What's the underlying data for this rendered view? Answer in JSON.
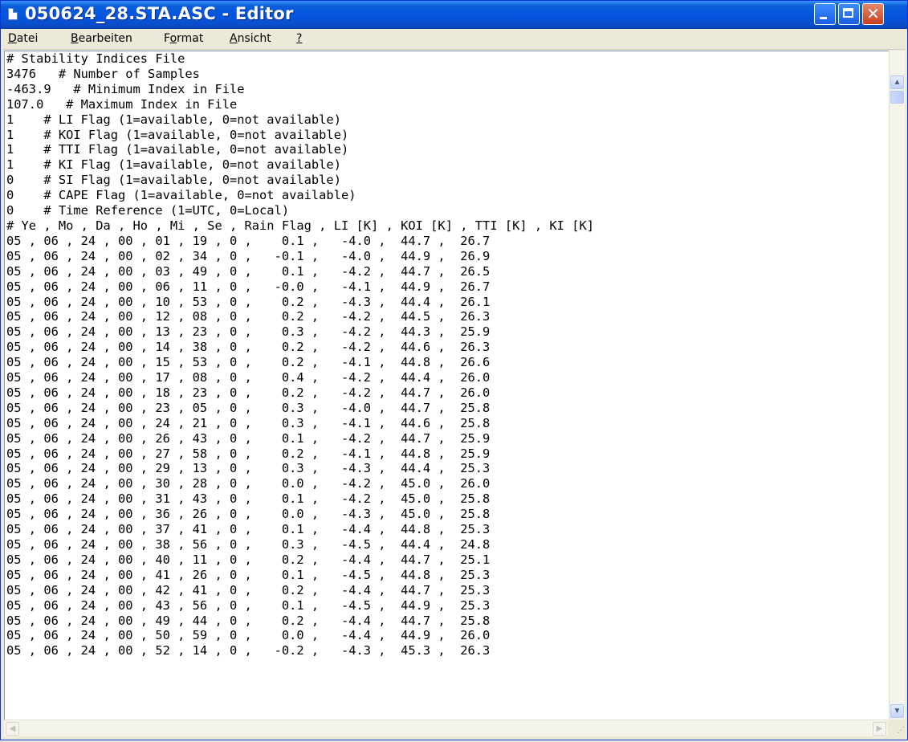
{
  "window": {
    "title": "050624_28.STA.ASC - Editor",
    "buttons": {
      "minimize": "minimize-icon",
      "maximize": "maximize-icon",
      "close": "close-icon"
    }
  },
  "menu": [
    {
      "accel": "D",
      "rest": "atei"
    },
    {
      "accel": "B",
      "rest": "earbeiten"
    },
    {
      "pre": "F",
      "accel": "o",
      "rest": "rmat"
    },
    {
      "accel": "A",
      "rest": "nsicht"
    },
    {
      "accel": "?",
      "rest": ""
    }
  ],
  "editor": {
    "lines": [
      "# Stability Indices File",
      "3476   # Number of Samples",
      "-463.9   # Minimum Index in File",
      "107.0   # Maximum Index in File",
      "1    # LI Flag (1=available, 0=not available)",
      "1    # KOI Flag (1=available, 0=not available)",
      "1    # TTI Flag (1=available, 0=not available)",
      "1    # KI Flag (1=available, 0=not available)",
      "0    # SI Flag (1=available, 0=not available)",
      "0    # CAPE Flag (1=available, 0=not available)",
      "0    # Time Reference (1=UTC, 0=Local)",
      "# Ye , Mo , Da , Ho , Mi , Se , Rain Flag , LI [K] , KOI [K] , TTI [K] , KI [K]",
      "05 , 06 , 24 , 00 , 01 , 19 , 0 ,    0.1 ,   -4.0 ,  44.7 ,  26.7",
      "05 , 06 , 24 , 00 , 02 , 34 , 0 ,   -0.1 ,   -4.0 ,  44.9 ,  26.9",
      "05 , 06 , 24 , 00 , 03 , 49 , 0 ,    0.1 ,   -4.2 ,  44.7 ,  26.5",
      "05 , 06 , 24 , 00 , 06 , 11 , 0 ,   -0.0 ,   -4.1 ,  44.9 ,  26.7",
      "05 , 06 , 24 , 00 , 10 , 53 , 0 ,    0.2 ,   -4.3 ,  44.4 ,  26.1",
      "05 , 06 , 24 , 00 , 12 , 08 , 0 ,    0.2 ,   -4.2 ,  44.5 ,  26.3",
      "05 , 06 , 24 , 00 , 13 , 23 , 0 ,    0.3 ,   -4.2 ,  44.3 ,  25.9",
      "05 , 06 , 24 , 00 , 14 , 38 , 0 ,    0.2 ,   -4.2 ,  44.6 ,  26.3",
      "05 , 06 , 24 , 00 , 15 , 53 , 0 ,    0.2 ,   -4.1 ,  44.8 ,  26.6",
      "05 , 06 , 24 , 00 , 17 , 08 , 0 ,    0.4 ,   -4.2 ,  44.4 ,  26.0",
      "05 , 06 , 24 , 00 , 18 , 23 , 0 ,    0.2 ,   -4.2 ,  44.7 ,  26.0",
      "05 , 06 , 24 , 00 , 23 , 05 , 0 ,    0.3 ,   -4.0 ,  44.7 ,  25.8",
      "05 , 06 , 24 , 00 , 24 , 21 , 0 ,    0.3 ,   -4.1 ,  44.6 ,  25.8",
      "05 , 06 , 24 , 00 , 26 , 43 , 0 ,    0.1 ,   -4.2 ,  44.7 ,  25.9",
      "05 , 06 , 24 , 00 , 27 , 58 , 0 ,    0.2 ,   -4.1 ,  44.8 ,  25.9",
      "05 , 06 , 24 , 00 , 29 , 13 , 0 ,    0.3 ,   -4.3 ,  44.4 ,  25.3",
      "05 , 06 , 24 , 00 , 30 , 28 , 0 ,    0.0 ,   -4.2 ,  45.0 ,  26.0",
      "05 , 06 , 24 , 00 , 31 , 43 , 0 ,    0.1 ,   -4.2 ,  45.0 ,  25.8",
      "05 , 06 , 24 , 00 , 36 , 26 , 0 ,    0.0 ,   -4.3 ,  45.0 ,  25.8",
      "05 , 06 , 24 , 00 , 37 , 41 , 0 ,    0.1 ,   -4.4 ,  44.8 ,  25.3",
      "05 , 06 , 24 , 00 , 38 , 56 , 0 ,    0.3 ,   -4.5 ,  44.4 ,  24.8",
      "05 , 06 , 24 , 00 , 40 , 11 , 0 ,    0.2 ,   -4.4 ,  44.7 ,  25.1",
      "05 , 06 , 24 , 00 , 41 , 26 , 0 ,    0.1 ,   -4.5 ,  44.8 ,  25.3",
      "05 , 06 , 24 , 00 , 42 , 41 , 0 ,    0.2 ,   -4.4 ,  44.7 ,  25.3",
      "05 , 06 , 24 , 00 , 43 , 56 , 0 ,    0.1 ,   -4.5 ,  44.9 ,  25.3",
      "05 , 06 , 24 , 00 , 49 , 44 , 0 ,    0.2 ,   -4.4 ,  44.7 ,  25.8",
      "05 , 06 , 24 , 00 , 50 , 59 , 0 ,    0.0 ,   -4.4 ,  44.9 ,  26.0",
      "05 , 06 , 24 , 00 , 52 , 14 , 0 ,   -0.2 ,   -4.3 ,  45.3 ,  26.3"
    ]
  },
  "colors": {
    "titlebar": "#0454e0",
    "close": "#c8401e",
    "face": "#ece9d8"
  }
}
